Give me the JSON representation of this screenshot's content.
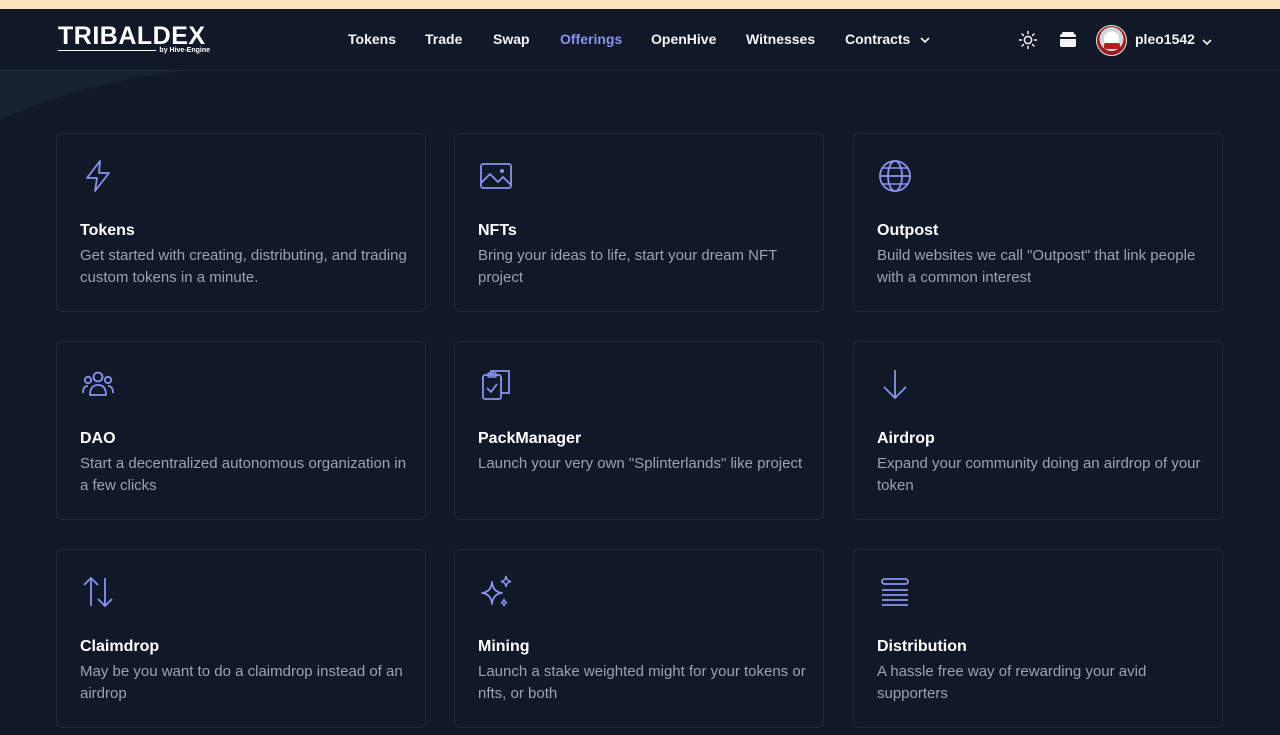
{
  "brand": {
    "logo_text": "TRIBALDEX",
    "logo_sub": "by Hive-Engine"
  },
  "nav": {
    "items": [
      {
        "label": "Tokens"
      },
      {
        "label": "Trade"
      },
      {
        "label": "Swap"
      },
      {
        "label": "Offerings",
        "active": true
      },
      {
        "label": "OpenHive"
      },
      {
        "label": "Witnesses"
      },
      {
        "label": "Contracts",
        "has_dropdown": true
      }
    ],
    "icons": [
      "sun-icon",
      "wallet-icon"
    ]
  },
  "user": {
    "name": "pleo1542"
  },
  "colors": {
    "accent": "#8b93f0",
    "background": "#111827",
    "card_border": "#1f2937",
    "muted_text": "#9ca3af"
  },
  "cards": [
    {
      "icon": "lightning-bolt-icon",
      "title": "Tokens",
      "description": "Get started with creating, distributing, and trading custom tokens in a minute."
    },
    {
      "icon": "image-icon",
      "title": "NFTs",
      "description": "Bring your ideas to life, start your dream NFT project"
    },
    {
      "icon": "globe-icon",
      "title": "Outpost",
      "description": "Build websites we call \"Outpost\" that link people with a common interest"
    },
    {
      "icon": "user-group-icon",
      "title": "DAO",
      "description": "Start a decentralized autonomous organization in a few clicks"
    },
    {
      "icon": "clipboard-check-icon",
      "title": "PackManager",
      "description": "Launch your very own \"Splinterlands\" like project"
    },
    {
      "icon": "arrow-down-icon",
      "title": "Airdrop",
      "description": "Expand your community doing an airdrop of your token"
    },
    {
      "icon": "arrows-up-down-icon",
      "title": "Claimdrop",
      "description": "May be you want to do a claimdrop instead of an airdrop"
    },
    {
      "icon": "sparkles-icon",
      "title": "Mining",
      "description": "Launch a stake weighted might for your tokens or nfts, or both"
    },
    {
      "icon": "stack-lines-icon",
      "title": "Distribution",
      "description": "A hassle free way of rewarding your avid supporters"
    }
  ]
}
